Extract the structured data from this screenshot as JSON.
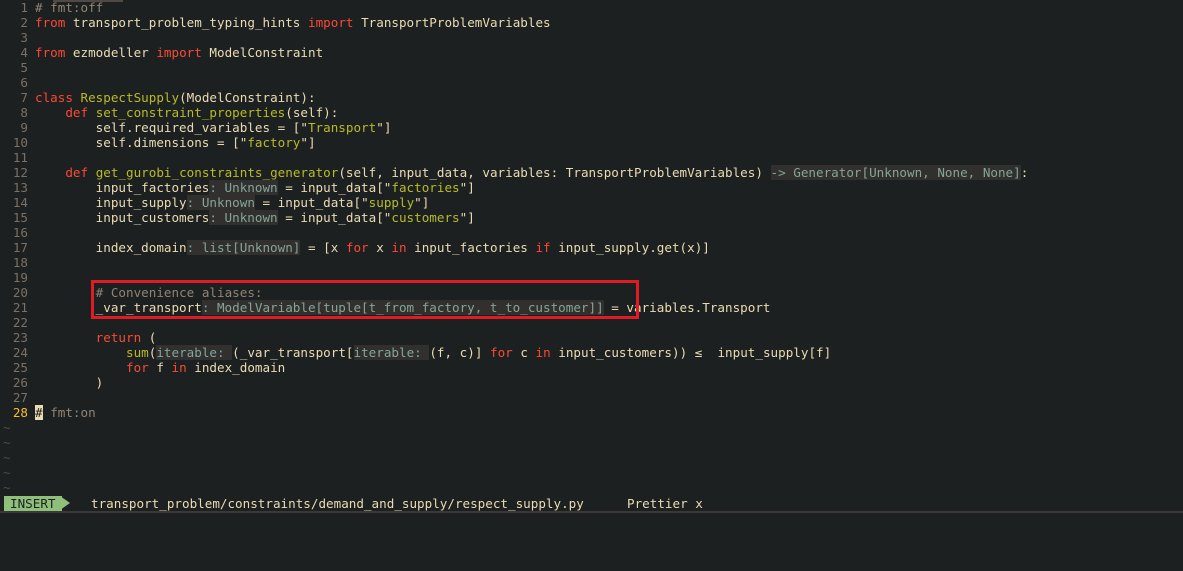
{
  "editor": {
    "lines": [
      {
        "n": "1",
        "html_parts": [
          {
            "c": "cmt",
            "t": "# fmt:off"
          }
        ]
      },
      {
        "n": "2",
        "html_parts": [
          {
            "c": "kw",
            "t": "from"
          },
          {
            "c": "",
            "t": " transport_problem_typing_hints "
          },
          {
            "c": "kw",
            "t": "import"
          },
          {
            "c": "",
            "t": " TransportProblemVariables"
          }
        ]
      },
      {
        "n": "3",
        "html_parts": []
      },
      {
        "n": "4",
        "html_parts": [
          {
            "c": "kw",
            "t": "from"
          },
          {
            "c": "",
            "t": " ezmodeller "
          },
          {
            "c": "kw",
            "t": "import"
          },
          {
            "c": "",
            "t": " ModelConstraint"
          }
        ]
      },
      {
        "n": "5",
        "html_parts": []
      },
      {
        "n": "6",
        "html_parts": []
      },
      {
        "n": "7",
        "html_parts": [
          {
            "c": "kw",
            "t": "class"
          },
          {
            "c": "",
            "t": " "
          },
          {
            "c": "fn",
            "t": "RespectSupply"
          },
          {
            "c": "",
            "t": "(ModelConstraint):"
          }
        ]
      },
      {
        "n": "8",
        "html_parts": [
          {
            "c": "",
            "t": "    "
          },
          {
            "c": "kw",
            "t": "def"
          },
          {
            "c": "",
            "t": " "
          },
          {
            "c": "fn",
            "t": "set_constraint_properties"
          },
          {
            "c": "",
            "t": "(self):"
          }
        ]
      },
      {
        "n": "9",
        "html_parts": [
          {
            "c": "",
            "t": "        self.required_variables = ["
          },
          {
            "c": "strq",
            "t": "\""
          },
          {
            "c": "str",
            "t": "Transport"
          },
          {
            "c": "strq",
            "t": "\""
          },
          {
            "c": "",
            "t": "]"
          }
        ]
      },
      {
        "n": "10",
        "html_parts": [
          {
            "c": "",
            "t": "        self.dimensions = ["
          },
          {
            "c": "strq",
            "t": "\""
          },
          {
            "c": "str",
            "t": "factory"
          },
          {
            "c": "strq",
            "t": "\""
          },
          {
            "c": "",
            "t": "]"
          }
        ]
      },
      {
        "n": "11",
        "html_parts": []
      },
      {
        "n": "12",
        "html_parts": [
          {
            "c": "",
            "t": "    "
          },
          {
            "c": "kw",
            "t": "def"
          },
          {
            "c": "",
            "t": " "
          },
          {
            "c": "fn",
            "t": "get_gurobi_constraints_generator"
          },
          {
            "c": "",
            "t": "(self, input_data, variables: TransportProblemVariables) "
          },
          {
            "c": "hint",
            "t": "-> Generator[Unknown, None, None]"
          },
          {
            "c": "",
            "t": ":"
          }
        ]
      },
      {
        "n": "13",
        "html_parts": [
          {
            "c": "",
            "t": "        input_factories"
          },
          {
            "c": "hint",
            "t": ": Unknown"
          },
          {
            "c": "",
            "t": " = input_data["
          },
          {
            "c": "strq",
            "t": "\""
          },
          {
            "c": "str",
            "t": "factories"
          },
          {
            "c": "strq",
            "t": "\""
          },
          {
            "c": "",
            "t": "]"
          }
        ]
      },
      {
        "n": "14",
        "html_parts": [
          {
            "c": "",
            "t": "        input_supply"
          },
          {
            "c": "hint",
            "t": ": Unknown"
          },
          {
            "c": "",
            "t": " = input_data["
          },
          {
            "c": "strq",
            "t": "\""
          },
          {
            "c": "str",
            "t": "supply"
          },
          {
            "c": "strq",
            "t": "\""
          },
          {
            "c": "",
            "t": "]"
          }
        ]
      },
      {
        "n": "15",
        "html_parts": [
          {
            "c": "",
            "t": "        input_customers"
          },
          {
            "c": "hint",
            "t": ": Unknown"
          },
          {
            "c": "",
            "t": " = input_data["
          },
          {
            "c": "strq",
            "t": "\""
          },
          {
            "c": "str",
            "t": "customers"
          },
          {
            "c": "strq",
            "t": "\""
          },
          {
            "c": "",
            "t": "]"
          }
        ]
      },
      {
        "n": "16",
        "html_parts": []
      },
      {
        "n": "17",
        "html_parts": [
          {
            "c": "",
            "t": "        index_domain"
          },
          {
            "c": "hint",
            "t": ": list[Unknown]"
          },
          {
            "c": "",
            "t": " = [x "
          },
          {
            "c": "kw",
            "t": "for"
          },
          {
            "c": "",
            "t": " x "
          },
          {
            "c": "kw",
            "t": "in"
          },
          {
            "c": "",
            "t": " input_factories "
          },
          {
            "c": "kw",
            "t": "if"
          },
          {
            "c": "",
            "t": " input_supply.get(x)]"
          }
        ]
      },
      {
        "n": "18",
        "html_parts": []
      },
      {
        "n": "19",
        "html_parts": []
      },
      {
        "n": "20",
        "html_parts": [
          {
            "c": "",
            "t": "        "
          },
          {
            "c": "cmt",
            "t": "# Convenience aliases:"
          }
        ]
      },
      {
        "n": "21",
        "html_parts": [
          {
            "c": "",
            "t": "        _var_transport"
          },
          {
            "c": "hint",
            "t": ": ModelVariable[tuple[t_from_factory, t_to_customer]]"
          },
          {
            "c": "",
            "t": " = variables.Transport"
          }
        ]
      },
      {
        "n": "22",
        "html_parts": []
      },
      {
        "n": "23",
        "html_parts": [
          {
            "c": "",
            "t": "        "
          },
          {
            "c": "kw",
            "t": "return"
          },
          {
            "c": "",
            "t": " ("
          }
        ]
      },
      {
        "n": "24",
        "html_parts": [
          {
            "c": "",
            "t": "            "
          },
          {
            "c": "fn",
            "t": "sum"
          },
          {
            "c": "",
            "t": "("
          },
          {
            "c": "hint",
            "t": "iterable: "
          },
          {
            "c": "",
            "t": "(_var_transport["
          },
          {
            "c": "hint",
            "t": "iterable: "
          },
          {
            "c": "",
            "t": "(f, c)] "
          },
          {
            "c": "kw",
            "t": "for"
          },
          {
            "c": "",
            "t": " c "
          },
          {
            "c": "kw",
            "t": "in"
          },
          {
            "c": "",
            "t": " input_customers)) ≤  input_supply[f]"
          }
        ]
      },
      {
        "n": "25",
        "html_parts": [
          {
            "c": "",
            "t": "            "
          },
          {
            "c": "kw",
            "t": "for"
          },
          {
            "c": "",
            "t": " f "
          },
          {
            "c": "kw",
            "t": "in"
          },
          {
            "c": "",
            "t": " index_domain"
          }
        ]
      },
      {
        "n": "26",
        "html_parts": [
          {
            "c": "",
            "t": "        )"
          }
        ]
      },
      {
        "n": "27",
        "html_parts": []
      },
      {
        "n": "28",
        "html_parts": [
          {
            "c": "cursor",
            "t": "#"
          },
          {
            "c": "",
            "t": " "
          },
          {
            "c": "cmt",
            "t": "fmt:on"
          }
        ],
        "current": true
      }
    ],
    "empty_marker": "~",
    "empty_marker_count": 5
  },
  "statusbar": {
    "mode": "INSERT",
    "file_path": "transport_problem/constraints/demand_and_supply/respect_supply.py",
    "formatter": "Prettier x"
  },
  "colors": {
    "background": "#1d2021",
    "keyword": "#fb4934",
    "function": "#b8bb26",
    "comment": "#928374",
    "inlay_hint": "#83a598",
    "mode_bg": "#8ec07c",
    "highlight_box": "#e01b24"
  }
}
